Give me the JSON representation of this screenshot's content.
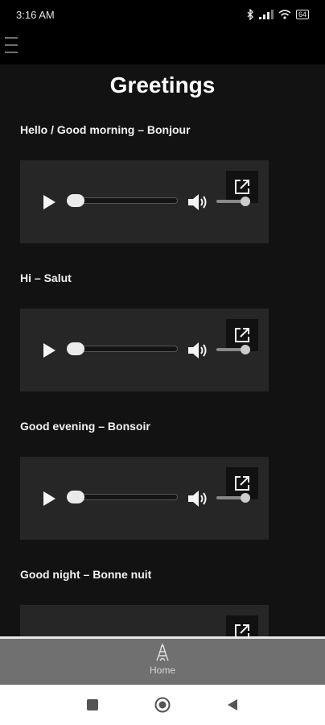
{
  "status_bar": {
    "time": "3:16 AM",
    "battery": "64",
    "icons": [
      "bluetooth-icon",
      "signal-icon",
      "wifi-icon",
      "battery-icon"
    ]
  },
  "top_bar": {
    "menu_icon": "hamburger-menu-icon"
  },
  "page": {
    "title": "Greetings"
  },
  "items": [
    {
      "label": "Hello / Good morning – Bonjour"
    },
    {
      "label": "Hi – Salut"
    },
    {
      "label": "Good evening – Bonsoir"
    },
    {
      "label": "Good night – Bonne nuit"
    }
  ],
  "player": {
    "icons": [
      "play-icon",
      "volume-icon",
      "open-external-icon"
    ],
    "seek_progress": 0,
    "volume_level": 1
  },
  "bottom_nav": {
    "home_label": "Home",
    "home_icon": "eiffel-tower-icon"
  },
  "system_nav": {
    "icons": [
      "recents-icon",
      "home-circle-icon",
      "back-triangle-icon"
    ]
  },
  "colors": {
    "background": "#121212",
    "player_bg": "#262626",
    "nav_bg": "#707070"
  }
}
